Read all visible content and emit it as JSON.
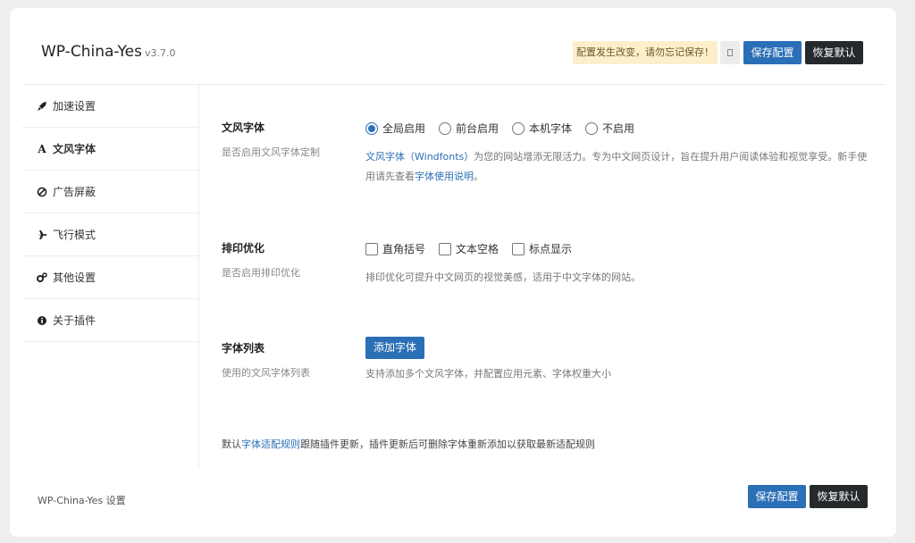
{
  "header": {
    "app_name": "WP-China-Yes",
    "version": "v3.7.0",
    "notice": "配置发生改变，请勿忘记保存！",
    "save_label": "保存配置",
    "reset_label": "恢复默认"
  },
  "sidebar": {
    "items": [
      {
        "label": "加速设置",
        "icon": "rocket-icon"
      },
      {
        "label": "文风字体",
        "icon": "font-icon",
        "glyph": "A"
      },
      {
        "label": "广告屏蔽",
        "icon": "ban-icon"
      },
      {
        "label": "飞行模式",
        "icon": "plane-icon"
      },
      {
        "label": "其他设置",
        "icon": "cogs-icon"
      },
      {
        "label": "关于插件",
        "icon": "info-icon"
      }
    ]
  },
  "sections": {
    "windfonts": {
      "title": "文风字体",
      "subtitle": "是否启用文风字体定制",
      "options": [
        "全局启用",
        "前台启用",
        "本机字体",
        "不启用"
      ],
      "selected": "全局启用",
      "desc_link1": "文风字体（Windfonts）",
      "desc_text1": "为您的网站增添无限活力。专为中文网页设计，旨在提升用户阅读体验和视觉享受。新手使用请先查看",
      "desc_link2": "字体使用说明",
      "desc_text2": "。"
    },
    "typography": {
      "title": "排印优化",
      "subtitle": "是否启用排印优化",
      "options": [
        "直角括号",
        "文本空格",
        "标点显示"
      ],
      "desc": "排印优化可提升中文网页的视觉美感，适用于中文字体的网站。"
    },
    "font_list": {
      "title": "字体列表",
      "subtitle": "使用的文风字体列表",
      "add_label": "添加字体",
      "desc": "支持添加多个文风字体，并配置应用元素、字体权重大小"
    },
    "footnote": {
      "prefix": "默认",
      "link": "字体适配规则",
      "suffix": "跟随插件更新，插件更新后可删除字体重新添加以获取最新适配规则"
    }
  },
  "footer": {
    "label": "WP-China-Yes 设置",
    "save_label": "保存配置",
    "reset_label": "恢复默认"
  },
  "colors": {
    "accent": "#2b6fb6",
    "dark_button": "#26292c",
    "notice_bg": "#fcefc9"
  }
}
